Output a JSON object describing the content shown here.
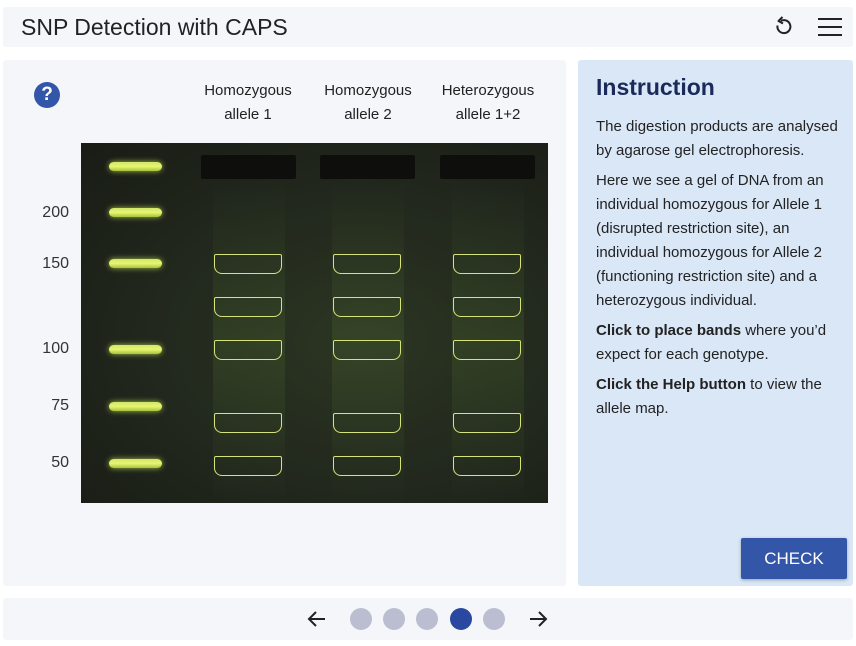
{
  "header": {
    "title": "SNP Detection with CAPS",
    "reload_icon": "reload-icon",
    "menu_icon": "hamburger-menu-icon"
  },
  "gel": {
    "help_label": "?",
    "columns": [
      {
        "line1": "Homozygous",
        "line2": "allele 1"
      },
      {
        "line1": "Homozygous",
        "line2": "allele 2"
      },
      {
        "line1": "Heterozygous",
        "line2": "allele 1+2"
      }
    ],
    "ladder_labels": [
      "200",
      "150",
      "100",
      "75",
      "50"
    ]
  },
  "instruction": {
    "title": "Instruction",
    "p1": "The digestion products are analysed by agarose gel electrophoresis.",
    "p2": "Here we see a gel of DNA from an individual homozygous for Allele 1 (disrupted restriction site), an individual homozygous for Allele 2 (functioning restriction site) and a heterozygous individual.",
    "p3_bold": "Click to place bands",
    "p3_rest": " where you’d expect for each genotype.",
    "p4_bold": "Click the Help button",
    "p4_rest": " to view the allele map.",
    "check_label": "CHECK"
  },
  "footer": {
    "prev_icon": "arrow-left-icon",
    "next_icon": "arrow-right-icon",
    "page_count": 5,
    "current_page": 4
  },
  "colors": {
    "accent": "#3456a8",
    "band": "#e2f26e",
    "panel_blue": "#d9e7f7"
  }
}
